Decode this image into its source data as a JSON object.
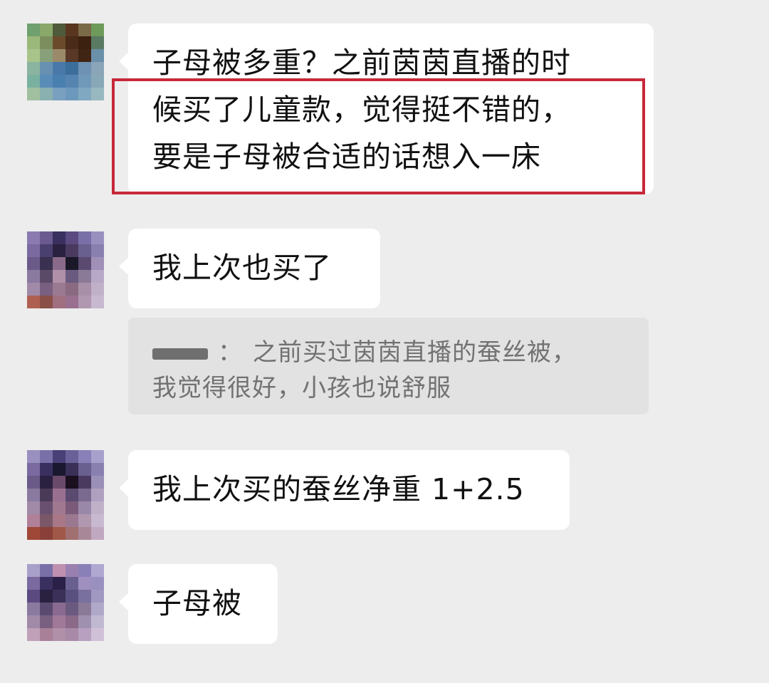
{
  "colors": {
    "background": "#ededed",
    "bubble": "#ffffff",
    "quote_background": "#e2e2e2",
    "highlight_border": "#c8283a"
  },
  "messages": [
    {
      "lines": [
        "子母被多重？之前茵茵直播的时",
        "候买了儿童款，觉得挺不错的，",
        "要是子母被合适的话想入一床"
      ]
    },
    {
      "text": "我上次也买了"
    },
    {
      "text": "我上次买的蚕丝净重 1+2.5"
    },
    {
      "text": "子母被"
    }
  ],
  "quote": {
    "separator": "：",
    "line1": "之前买过茵茵直播的蚕丝被，",
    "line2": "我觉得很好，小孩也说舒服"
  },
  "avatars": [
    {
      "icon": "pixelated-avatar",
      "colors": [
        "#6fa06e",
        "#8aa86a",
        "#4e5a3a",
        "#5a3520",
        "#7a6a48",
        "#6e9a5a",
        "#9ab87a",
        "#7c8e5e",
        "#6a4a2a",
        "#4a2a18",
        "#3c2010",
        "#5a7a62",
        "#a8c48a",
        "#88a07a",
        "#9a8a6a",
        "#5a3828",
        "#402414",
        "#6a90aa",
        "#8ab4a0",
        "#6890b0",
        "#4a78a8",
        "#3c6e9c",
        "#6e92b4",
        "#8aa4b8",
        "#7ab0a0",
        "#5a8cb8",
        "#4a80b0",
        "#5684b0",
        "#7098b8",
        "#88a8b8",
        "#a0c0a0",
        "#8ab0b0",
        "#7aa0c0",
        "#6c98bc",
        "#80a8c0",
        "#98b8c0"
      ]
    },
    {
      "icon": "pixelated-avatar",
      "colors": [
        "#8a7ab0",
        "#6a5a90",
        "#3a3060",
        "#5a4a80",
        "#7a70a8",
        "#9a90c0",
        "#7a6aa0",
        "#4a4070",
        "#2a2040",
        "#4a3a60",
        "#6a6090",
        "#8a80b0",
        "#6a5a88",
        "#3a3050",
        "#8a6a8a",
        "#1a1828",
        "#5a4a70",
        "#a090b8",
        "#8a7aa0",
        "#5a4a68",
        "#b090a8",
        "#6a5a80",
        "#8a7a98",
        "#b8a8c8",
        "#a08aa8",
        "#7a6080",
        "#9a7a90",
        "#8a6a80",
        "#a890a8",
        "#c0b0c8",
        "#b06050",
        "#8a5048",
        "#a07080",
        "#9a7090",
        "#b098b0",
        "#c8b8d0"
      ]
    },
    {
      "icon": "pixelated-avatar",
      "colors": [
        "#9a90c0",
        "#7a70a8",
        "#4a4078",
        "#6a6098",
        "#8a80b8",
        "#a8a0cc",
        "#7a6aa0",
        "#3a3060",
        "#1a1830",
        "#3a3058",
        "#6a6090",
        "#8a80b0",
        "#6a5a88",
        "#2a2040",
        "#6a4a6a",
        "#1a1020",
        "#4a3a60",
        "#9a90b8",
        "#8a7aa0",
        "#4a3a58",
        "#9a7090",
        "#5a4a70",
        "#7a6a90",
        "#b0a0c0",
        "#a08aa8",
        "#6a5070",
        "#a07890",
        "#7a5a78",
        "#9a88a8",
        "#c0b0c8",
        "#b08098",
        "#7a5868",
        "#a87888",
        "#9a7890",
        "#b098b0",
        "#c8b8d0",
        "#a04838",
        "#8a4038",
        "#a05848",
        "#a07070",
        "#a88898",
        "#c0a8c0"
      ]
    },
    {
      "icon": "pixelated-avatar",
      "colors": [
        "#a8a0c8",
        "#7a70a8",
        "#c090b0",
        "#9a80b0",
        "#8a80b8",
        "#b0a8d0",
        "#7a6aa0",
        "#3a3060",
        "#2a2048",
        "#6a6090",
        "#a090c0",
        "#9a90c0",
        "#5a4a80",
        "#2a2040",
        "#3a3058",
        "#5a5080",
        "#7a70a0",
        "#a098c0",
        "#8a7aa0",
        "#5a4a70",
        "#8a6a90",
        "#6a5a80",
        "#8a7a98",
        "#b0a8c8",
        "#a08aa8",
        "#7a6080",
        "#a07898",
        "#8a6a88",
        "#a090b0",
        "#c0b8d0",
        "#c0a0b8",
        "#a88098",
        "#b090a8",
        "#a88aa8",
        "#b8a0c0",
        "#d0c0d8"
      ]
    }
  ]
}
